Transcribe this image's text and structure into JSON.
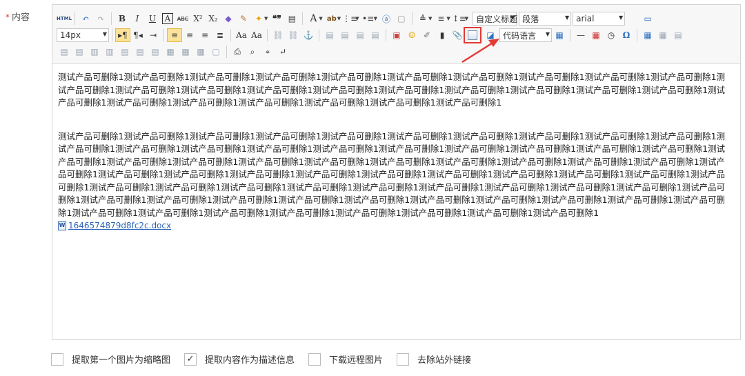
{
  "field": {
    "required_mark": "*",
    "label": "内容"
  },
  "toolbar": {
    "row1": {
      "html_label": "HTML",
      "bold": "B",
      "italic": "I",
      "underline": "U",
      "border_text": "A",
      "strike": "ABC",
      "superscript": "X²",
      "subscript": "X₂",
      "quote": "❝❞",
      "font_color": "A",
      "highlight": "ab",
      "custom_title": "自定义标题",
      "paragraph": "段落",
      "font_family": "arial"
    },
    "row2": {
      "font_size": "14px",
      "code_language": "代码语言"
    }
  },
  "content": {
    "paragraph1": "测试产品可删除1测试产品可删除1测试产品可删除1测试产品可删除1测试产品可删除1测试产品可删除1测试产品可删除1测试产品可删除1测试产品可删除1测试产品可删除1测试产品可删除1测试产品可删除1测试产品可删除1测试产品可删除1测试产品可删除1测试产品可删除1测试产品可删除1测试产品可删除1测试产品可删除1测试产品可删除1测试产品可删除1测试产品可删除1测试产品可删除1测试产品可删除1测试产品可删除1测试产品可删除1测试产品可删除1",
    "paragraph2": "测试产品可删除1测试产品可删除1测试产品可删除1测试产品可删除1测试产品可删除1测试产品可删除1测试产品可删除1测试产品可删除1测试产品可删除1测试产品可删除1测试产品可删除1测试产品可删除1测试产品可删除1测试产品可删除1测试产品可删除1测试产品可删除1测试产品可删除1测试产品可删除1测试产品可删除1测试产品可删除1测试产品可删除1测试产品可删除1测试产品可删除1测试产品可删除1测试产品可删除1测试产品可删除1测试产品可删除1测试产品可删除1测试产品可删除1测试产品可删除1测试产品可删除1测试产品可删除1测试产品可删除1测试产品可删除1测试产品可删除1测试产品可删除1测试产品可删除1测试产品可删除1测试产品可删除1测试产品可删除1测试产品可删除1测试产品可删除1测试产品可删除1测试产品可删除1测试产品可删除1测试产品可删除1测试产品可删除1测试产品可删除1测试产品可删除1测试产品可删除1测试产品可删除1测试产品可删除1测试产品可删除1测试产品可删除1测试产品可删除1测试产品可删除1测试产品可删除1测试产品可删除1测试产品可删除1测试产品可删除1测试产品可删除1测试产品可删除1测试产品可删除1测试产品可删除1测试产品可删除1测试产品可删除1测试产品可删除1测试产品可删除1测试产品可删除1",
    "attachment_name": "1646574879d8fc2c.docx",
    "attachment_icon": "word-file-icon"
  },
  "options": [
    {
      "label": "提取第一个图片为缩略图",
      "checked": false
    },
    {
      "label": "提取内容作为描述信息",
      "checked": true
    },
    {
      "label": "下载远程图片",
      "checked": false
    },
    {
      "label": "去除站外链接",
      "checked": false
    }
  ],
  "annotation": {
    "color": "#e53935",
    "highlighted_button": "insert-image-button"
  }
}
